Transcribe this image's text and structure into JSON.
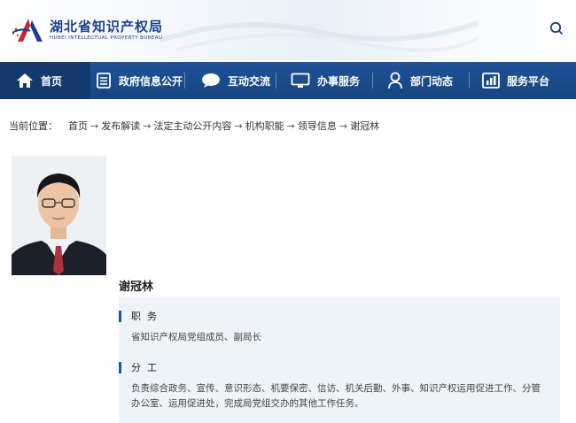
{
  "header": {
    "logo_cn": "湖北省知识产权局",
    "logo_en": "HUBEI INTELLECTUAL PROPERTY BUREAU",
    "search_icon": "search-icon"
  },
  "nav": {
    "items": [
      {
        "label": "首页",
        "icon": "home-icon"
      },
      {
        "label": "政府信息公开",
        "icon": "document-list-icon"
      },
      {
        "label": "互动交流",
        "icon": "chat-bubble-icon"
      },
      {
        "label": "办事服务",
        "icon": "monitor-icon"
      },
      {
        "label": "部门动态",
        "icon": "person-icon"
      },
      {
        "label": "服务平台",
        "icon": "chart-icon"
      }
    ],
    "colors": {
      "bg": "#1a4a8c",
      "active": "#153b6e"
    }
  },
  "breadcrumb": {
    "lead": "当前位置：",
    "items": [
      "首页",
      "发布解读",
      "法定主动公开内容",
      "机构职能",
      "领导信息",
      "谢冠林"
    ],
    "separator": "→"
  },
  "profile": {
    "name": "谢冠林",
    "sections": [
      {
        "title": "职务",
        "text": "省知识产权局党组成员、副局长"
      },
      {
        "title": "分工",
        "text": "负责综合政务、宣传、意识形态、机要保密、信访、机关后勤、外事、知识产权运用促进工作、分管办公室、运用促进处，完成局党组交办的其他工作任务。"
      }
    ],
    "accent": "#1a56a8"
  }
}
